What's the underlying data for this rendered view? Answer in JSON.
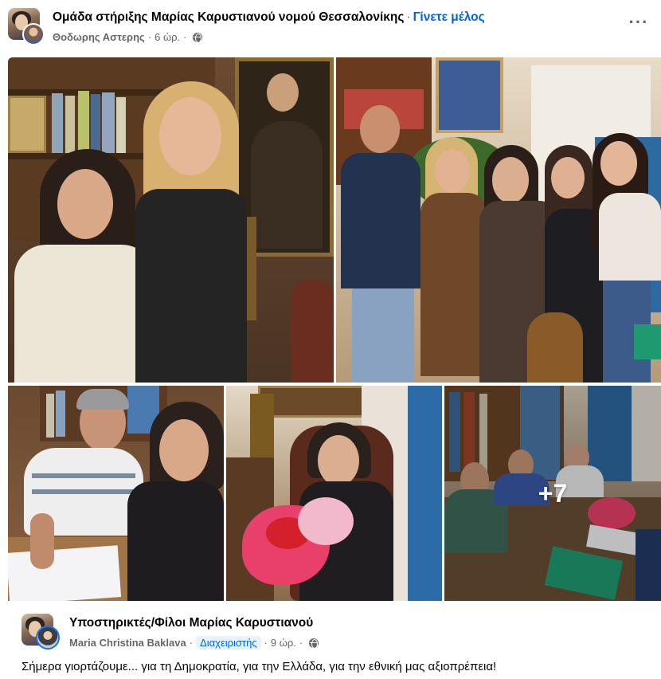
{
  "header": {
    "group_name": "Ομάδα στήριξης Μαρίας Καρυστιανού νομού Θεσσαλονίκης",
    "separator": "·",
    "join_label": "Γίνετε μέλος",
    "author": "Θοδωρης Αστερης",
    "time": "6 ώρ.",
    "more_label": "···",
    "audience_icon": "globe-icon"
  },
  "photos": {
    "count": 5,
    "more_count_label": "+7"
  },
  "shared_post": {
    "group_name": "Υποστηρικτές/Φίλοι Μαρίας Καρυστιανού",
    "author": "Maria Christina Baklava",
    "role_badge": "Διαχειριστής",
    "separator": "·",
    "time": "9 ώρ.",
    "audience_icon": "globe-icon",
    "text": "Σήμερα γιορτάζουμε... για τη Δημοκρατία, για την Ελλάδα, για την εθνική μας αξιοπρέπεια!"
  },
  "colors": {
    "link_blue": "#0064d1",
    "meta_gray": "#65676b",
    "text": "#050505"
  }
}
